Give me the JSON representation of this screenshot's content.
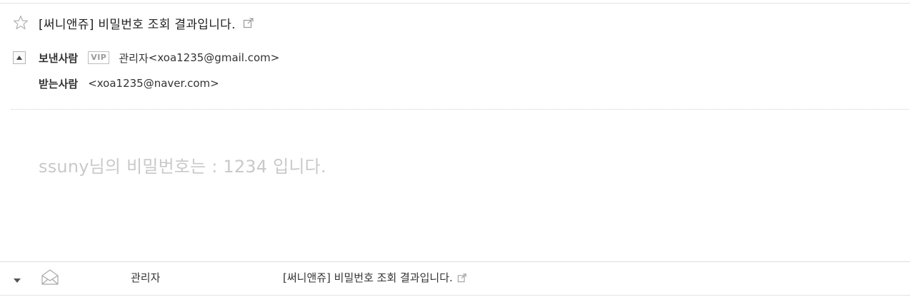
{
  "mail": {
    "subject": "[써니앤쥬] 비밀번호 조회 결과입니다.",
    "sender_label": "보낸사람",
    "vip_badge": "VIP",
    "sender_name": "관리자",
    "sender_address": "<xoa1235@gmail.com>",
    "recipient_label": "받는사람",
    "recipient_address": "<xoa1235@naver.com>",
    "body": "ssuny님의 비밀번호는 : 1234 입니다."
  },
  "list_row": {
    "sender": "관리자",
    "subject": "[써니앤쥬] 비밀번호 조회 결과입니다."
  },
  "icons": {
    "star": "star-outline-icon",
    "popout": "external-link-icon",
    "collapse": "caret-up-icon",
    "expand": "caret-down-icon",
    "envelope": "envelope-open-icon"
  },
  "colors": {
    "text": "#333333",
    "muted": "#c9c9c9",
    "divider": "#dcdcdc"
  }
}
